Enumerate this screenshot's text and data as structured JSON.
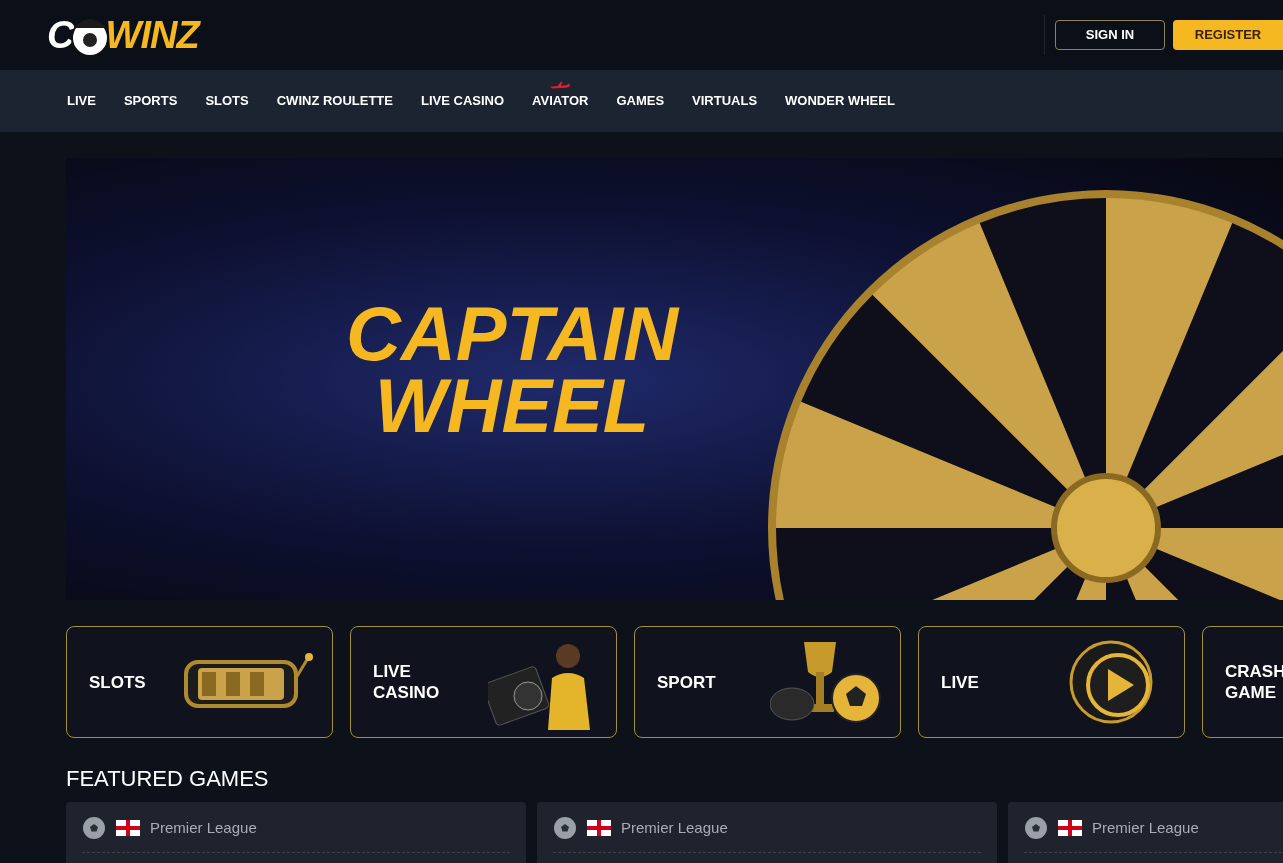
{
  "header": {
    "logo": {
      "lead": "C",
      "tail": "WINZ"
    },
    "sign_in": "SIGN IN",
    "register": "REGISTER"
  },
  "nav": [
    {
      "label": "LIVE",
      "marked": false
    },
    {
      "label": "SPORTS",
      "marked": false
    },
    {
      "label": "SLOTS",
      "marked": false
    },
    {
      "label": "CWINZ ROULETTE",
      "marked": false
    },
    {
      "label": "LIVE CASINO",
      "marked": false
    },
    {
      "label": "AVIATOR",
      "marked": true
    },
    {
      "label": "GAMES",
      "marked": false
    },
    {
      "label": "VIRTUALS",
      "marked": false
    },
    {
      "label": "WONDER WHEEL",
      "marked": false
    }
  ],
  "banner": {
    "title": [
      "CAPTAIN",
      "WHEEL"
    ]
  },
  "categories": [
    {
      "kind": "slots",
      "lines": [
        "SLOTS"
      ]
    },
    {
      "kind": "casino",
      "lines": [
        "LIVE",
        "CASINO"
      ]
    },
    {
      "kind": "sport",
      "lines": [
        "SPORT"
      ]
    },
    {
      "kind": "live",
      "lines": [
        "LIVE"
      ]
    },
    {
      "kind": "crash",
      "lines": [
        "CRASH",
        "GAME"
      ]
    }
  ],
  "featured": {
    "title": "FEATURED GAMES",
    "cards": [
      {
        "league": "Premier League"
      },
      {
        "league": "Premier League"
      },
      {
        "league": "Premier League"
      }
    ]
  }
}
